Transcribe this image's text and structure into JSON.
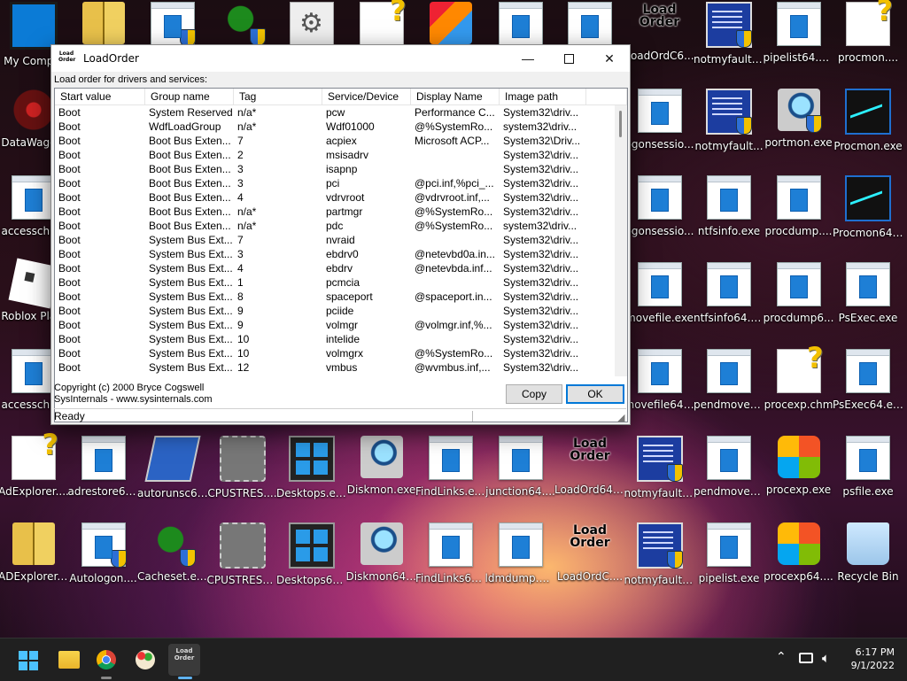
{
  "desktop": {
    "icons": [
      {
        "label": "My Comp...",
        "icon": "monitor-icon"
      },
      {
        "label": "",
        "icon": "book-icon"
      },
      {
        "label": "",
        "icon": "window-shield-icon"
      },
      {
        "label": "",
        "icon": "duck-shield-icon"
      },
      {
        "label": "",
        "icon": "gear-file-icon"
      },
      {
        "label": "",
        "icon": "help-file-icon"
      },
      {
        "label": "",
        "icon": "installer-icon"
      },
      {
        "label": "",
        "icon": "window-icon"
      },
      {
        "label": "",
        "icon": "window-icon"
      },
      {
        "label": "LoadOrdC6...",
        "icon": "loadorder-icon"
      },
      {
        "label": "notmyfaultc...",
        "icon": "bsod-shield-icon"
      },
      {
        "label": "pipelist64.exe",
        "icon": "window-icon"
      },
      {
        "label": "procmon....",
        "icon": "help-file-icon"
      },
      {
        "label": "DataWago...",
        "icon": "datawago-icon"
      },
      {
        "label": "ogonsessio...",
        "icon": "window-icon"
      },
      {
        "label": "notmyfault...",
        "icon": "bsod-shield-icon"
      },
      {
        "label": "portmon.exe",
        "icon": "magnifier-shield-icon"
      },
      {
        "label": "Procmon.exe",
        "icon": "procmon-icon"
      },
      {
        "label": "accesschk...",
        "icon": "window-icon"
      },
      {
        "label": "ogonsessio...",
        "icon": "window-icon"
      },
      {
        "label": "ntfsinfo.exe",
        "icon": "window-icon"
      },
      {
        "label": "procdump....",
        "icon": "window-icon"
      },
      {
        "label": "Procmon64....",
        "icon": "procmon-icon"
      },
      {
        "label": "Roblox Pla...",
        "icon": "roblox-icon"
      },
      {
        "label": "movefile.exe",
        "icon": "window-icon"
      },
      {
        "label": "ntfsinfo64.exe",
        "icon": "window-icon"
      },
      {
        "label": "procdump6...",
        "icon": "window-icon"
      },
      {
        "label": "PsExec.exe",
        "icon": "window-icon"
      },
      {
        "label": "accesschk...",
        "icon": "window-icon"
      },
      {
        "label": "movefile64....",
        "icon": "window-icon"
      },
      {
        "label": "pendmoves....",
        "icon": "window-icon"
      },
      {
        "label": "procexp.chm",
        "icon": "help-file-icon"
      },
      {
        "label": "PsExec64.exe",
        "icon": "window-icon"
      },
      {
        "label": "AdExplorer....",
        "icon": "help-file-icon"
      },
      {
        "label": "adrestore64....",
        "icon": "window-icon"
      },
      {
        "label": "autorunsc64....",
        "icon": "autoruns-icon"
      },
      {
        "label": "CPUSTRES....",
        "icon": "chip-icon"
      },
      {
        "label": "Desktops.exe",
        "icon": "desktops-icon"
      },
      {
        "label": "Diskmon.exe",
        "icon": "diskmon-icon"
      },
      {
        "label": "FindLinks.exe",
        "icon": "window-icon"
      },
      {
        "label": "junction64....",
        "icon": "window-icon"
      },
      {
        "label": "LoadOrd64....",
        "icon": "loadorder-icon"
      },
      {
        "label": "notmyfault....",
        "icon": "bsod-shield-icon"
      },
      {
        "label": "pendmoves....",
        "icon": "window-icon"
      },
      {
        "label": "procexp.exe",
        "icon": "procexp-icon"
      },
      {
        "label": "psfile.exe",
        "icon": "window-icon"
      },
      {
        "label": "ADExplorer....",
        "icon": "book-icon"
      },
      {
        "label": "Autologon....",
        "icon": "window-shield-icon"
      },
      {
        "label": "Cacheset.exe",
        "icon": "duck-shield-icon"
      },
      {
        "label": "CPUSTRES6....",
        "icon": "chip-icon"
      },
      {
        "label": "Desktops64....",
        "icon": "desktops-icon"
      },
      {
        "label": "Diskmon64....",
        "icon": "diskmon-icon"
      },
      {
        "label": "FindLinks64....",
        "icon": "window-icon"
      },
      {
        "label": "ldmdump.exe",
        "icon": "window-icon"
      },
      {
        "label": "LoadOrdC....",
        "icon": "loadorder-icon"
      },
      {
        "label": "notmyfault6....",
        "icon": "bsod-shield-icon"
      },
      {
        "label": "pipelist.exe",
        "icon": "window-icon"
      },
      {
        "label": "procexp64....",
        "icon": "procexp-icon"
      },
      {
        "label": "Recycle Bin",
        "icon": "recycle-bin-icon"
      }
    ]
  },
  "window": {
    "title": "LoadOrder",
    "icon_text": "Load Order",
    "caption": "Load order for drivers and services:",
    "columns": [
      "Start value",
      "Group name",
      "Tag",
      "Service/Device",
      "Display Name",
      "Image path"
    ],
    "rows": [
      [
        "Boot",
        "System Reserved",
        "n/a*",
        "pcw",
        "Performance C...",
        "System32\\driv..."
      ],
      [
        "Boot",
        "WdfLoadGroup",
        "n/a*",
        "Wdf01000",
        "@%SystemRo...",
        "system32\\driv..."
      ],
      [
        "Boot",
        "Boot Bus Exten...",
        "7",
        "acpiex",
        "Microsoft ACP...",
        "System32\\Driv..."
      ],
      [
        "Boot",
        "Boot Bus Exten...",
        "2",
        "msisadrv",
        "",
        "System32\\driv..."
      ],
      [
        "Boot",
        "Boot Bus Exten...",
        "3",
        "isapnp",
        "",
        "System32\\driv..."
      ],
      [
        "Boot",
        "Boot Bus Exten...",
        "3",
        "pci",
        "@pci.inf,%pci_...",
        "System32\\driv..."
      ],
      [
        "Boot",
        "Boot Bus Exten...",
        "4",
        "vdrvroot",
        "@vdrvroot.inf,...",
        "System32\\driv..."
      ],
      [
        "Boot",
        "Boot Bus Exten...",
        "n/a*",
        "partmgr",
        "@%SystemRo...",
        "System32\\driv..."
      ],
      [
        "Boot",
        "Boot Bus Exten...",
        "n/a*",
        "pdc",
        "@%SystemRo...",
        "system32\\driv..."
      ],
      [
        "Boot",
        "System Bus Ext...",
        "7",
        "nvraid",
        "",
        "System32\\driv..."
      ],
      [
        "Boot",
        "System Bus Ext...",
        "3",
        "ebdrv0",
        "@netevbd0a.in...",
        "System32\\driv..."
      ],
      [
        "Boot",
        "System Bus Ext...",
        "4",
        "ebdrv",
        "@netevbda.inf...",
        "System32\\driv..."
      ],
      [
        "Boot",
        "System Bus Ext...",
        "1",
        "pcmcia",
        "",
        "System32\\driv..."
      ],
      [
        "Boot",
        "System Bus Ext...",
        "8",
        "spaceport",
        "@spaceport.in...",
        "System32\\driv..."
      ],
      [
        "Boot",
        "System Bus Ext...",
        "9",
        "pciide",
        "",
        "System32\\driv..."
      ],
      [
        "Boot",
        "System Bus Ext...",
        "9",
        "volmgr",
        "@volmgr.inf,%...",
        "System32\\driv..."
      ],
      [
        "Boot",
        "System Bus Ext...",
        "10",
        "intelide",
        "",
        "System32\\driv..."
      ],
      [
        "Boot",
        "System Bus Ext...",
        "10",
        "volmgrx",
        "@%SystemRo...",
        "System32\\driv..."
      ],
      [
        "Boot",
        "System Bus Ext...",
        "12",
        "vmbus",
        "@wvmbus.inf,...",
        "System32\\driv..."
      ]
    ],
    "copyright": "Copyright (c) 2000 Bryce Cogswell",
    "website": "SysInternals - www.sysinternals.com",
    "copy_label": "Copy",
    "ok_label": "OK",
    "status": "Ready"
  },
  "taskbar": {
    "loadorder_icon_text": "Load Order",
    "time": "6:17 PM",
    "date": "9/1/2022"
  },
  "colors": {
    "accent": "#0078d7",
    "taskbar": "#202020"
  }
}
